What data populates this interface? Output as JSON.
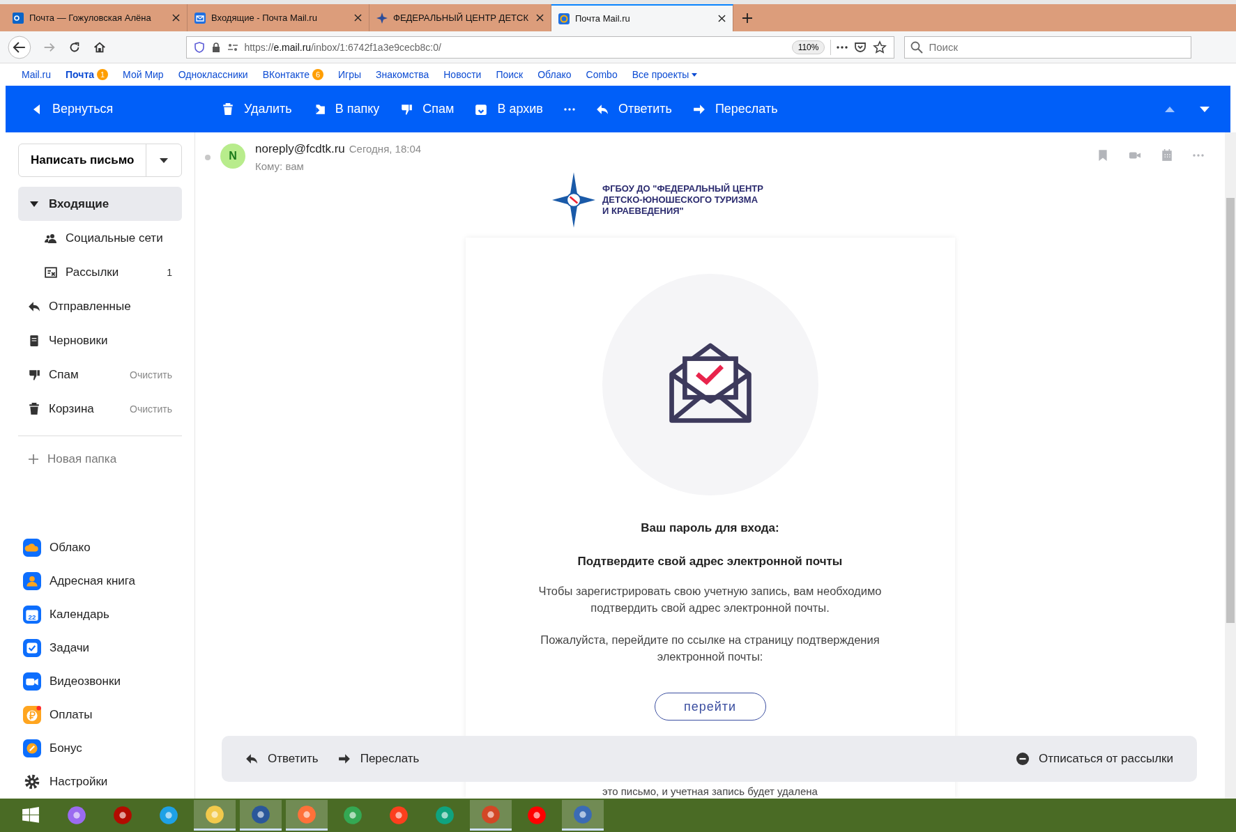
{
  "browser": {
    "tabs": [
      {
        "title": "Почта — Гожуловская Алёна",
        "kind": "outlook",
        "selected": false
      },
      {
        "title": "Входящие - Почта Mail.ru",
        "kind": "envelope",
        "selected": false
      },
      {
        "title": "ФЕДЕРАЛЬНЫЙ ЦЕНТР ДЕТСК",
        "kind": "compass",
        "selected": false
      },
      {
        "title": "Почта Mail.ru",
        "kind": "at",
        "selected": true
      }
    ],
    "url": {
      "scheme": "https://",
      "host": "e.mail.ru",
      "path": "/inbox/1:6742f1a3e9cecb8c:0/"
    },
    "zoom": "110%",
    "search_placeholder": "Поиск"
  },
  "portal_bar": [
    {
      "label": "Mail.ru",
      "selected": false
    },
    {
      "label": "Почта",
      "badge": "1",
      "selected": true
    },
    {
      "label": "Мой Мир",
      "selected": false
    },
    {
      "label": "Одноклассники",
      "selected": false
    },
    {
      "label": "ВКонтакте",
      "badge": "6",
      "selected": false
    },
    {
      "label": "Игры",
      "selected": false
    },
    {
      "label": "Знакомства",
      "selected": false
    },
    {
      "label": "Новости",
      "selected": false
    },
    {
      "label": "Поиск",
      "selected": false
    },
    {
      "label": "Облако",
      "selected": false
    },
    {
      "label": "Combo",
      "selected": false
    },
    {
      "label": "Все проекты",
      "selected": false,
      "dropdown": true
    }
  ],
  "toolbar": {
    "back": "Вернуться",
    "actions": [
      {
        "label": "Удалить",
        "kind": "trash"
      },
      {
        "label": "В папку",
        "kind": "folder"
      },
      {
        "label": "Спам",
        "kind": "dislike"
      },
      {
        "label": "В архив",
        "kind": "archive"
      },
      {
        "kind": "more"
      },
      {
        "label": "Ответить",
        "kind": "reply"
      },
      {
        "label": "Переслать",
        "kind": "forward"
      }
    ]
  },
  "sidebar": {
    "compose": "Написать письмо",
    "folders": [
      {
        "label": "Входящие",
        "kind": "inbox",
        "selected": true,
        "expanded": true,
        "children": [
          {
            "label": "Социальные сети",
            "kind": "people",
            "selected": false
          },
          {
            "label": "Рассылки",
            "kind": "newsletter",
            "count": "1",
            "selected": false
          }
        ]
      },
      {
        "label": "Отправленные",
        "kind": "sent",
        "selected": false
      },
      {
        "label": "Черновики",
        "kind": "draft",
        "selected": false
      },
      {
        "label": "Спам",
        "kind": "dislike",
        "action": "Очистить",
        "selected": false
      },
      {
        "label": "Корзина",
        "kind": "trash",
        "action": "Очистить",
        "selected": false
      }
    ],
    "new_folder": "Новая папка",
    "apps": [
      {
        "label": "Облако",
        "kind": "cloud"
      },
      {
        "label": "Адресная книга",
        "kind": "contacts"
      },
      {
        "label": "Календарь",
        "kind": "calendar",
        "icon_text": "22"
      },
      {
        "label": "Задачи",
        "kind": "tasks"
      },
      {
        "label": "Видеозвонки",
        "kind": "video"
      },
      {
        "label": "Оплаты",
        "kind": "pay",
        "notification": true
      },
      {
        "label": "Бонус",
        "kind": "bonus"
      },
      {
        "label": "Настройки",
        "kind": "settings"
      }
    ]
  },
  "message": {
    "avatar": "N",
    "sender": "noreply@fcdtk.ru",
    "date": "Сегодня, 18:04",
    "to": "Кому: вам",
    "logo_lines": [
      "ФГБОУ ДО \"ФЕДЕРАЛЬНЫЙ ЦЕНТР",
      "ДЕТСКО-ЮНОШЕСКОГО ТУРИЗМА",
      "И КРАЕВЕДЕНИЯ\""
    ],
    "heading": "Ваш пароль для входа:",
    "subheading": "Подтвердите свой адрес электронной почты",
    "paragraphs": [
      "Чтобы зарегистрировать свою учетную запись, вам необходимо подтвердить свой адрес электронной почты.",
      "Пожалуйста, перейдите по ссылке на страницу подтверждения электронной почты:"
    ],
    "button": "перейти",
    "footer_text": "это письмо, и учетная запись будет удалена"
  },
  "reply_bar": {
    "reply": "Ответить",
    "forward": "Переслать",
    "unsubscribe": "Отписаться от рассылки"
  },
  "taskbar": [
    {
      "kind": "start",
      "selected": false
    },
    {
      "kind": "alice",
      "selected": false
    },
    {
      "kind": "pdf",
      "selected": false
    },
    {
      "kind": "ie",
      "selected": false
    },
    {
      "kind": "explorer",
      "selected": true
    },
    {
      "kind": "word",
      "selected": true
    },
    {
      "kind": "firefox",
      "selected": true
    },
    {
      "kind": "chrome",
      "selected": false
    },
    {
      "kind": "yandex",
      "selected": false
    },
    {
      "kind": "edge",
      "selected": false
    },
    {
      "kind": "powerpoint",
      "selected": true
    },
    {
      "kind": "ybrowser",
      "selected": false
    },
    {
      "kind": "paint",
      "selected": true
    }
  ]
}
